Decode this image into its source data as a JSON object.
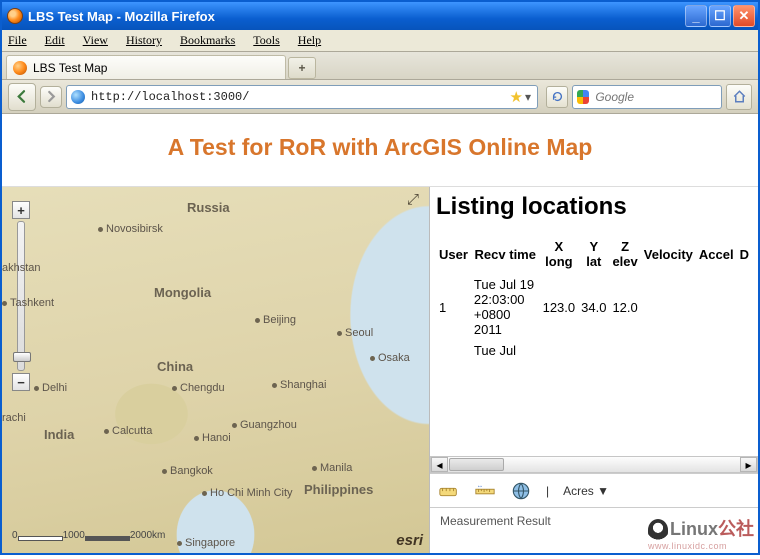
{
  "window": {
    "title": "LBS Test Map - Mozilla Firefox"
  },
  "menu": {
    "file": "File",
    "edit": "Edit",
    "view": "View",
    "history": "History",
    "bookmarks": "Bookmarks",
    "tools": "Tools",
    "help": "Help"
  },
  "tab": {
    "title": "LBS Test Map",
    "newtab": "+"
  },
  "address": {
    "url": "http://localhost:3000/"
  },
  "search": {
    "placeholder": "Google"
  },
  "page": {
    "heading": "A Test for RoR with ArcGIS Online Map",
    "listing_title": "Listing locations",
    "columns": [
      "User",
      "Recv time",
      "X long",
      "Y lat",
      "Z elev",
      "Velocity",
      "Accel",
      "D"
    ],
    "rows": [
      {
        "user": "1",
        "recv": "Tue Jul 19 22:03:00 +0800 2011",
        "x": "123.0",
        "y": "34.0",
        "z": "12.0",
        "velocity": "",
        "accel": "",
        "d": ""
      },
      {
        "user": "",
        "recv": "Tue Jul",
        "x": "",
        "y": "",
        "z": "",
        "velocity": "",
        "accel": "",
        "d": ""
      }
    ],
    "toolbar": {
      "unit_label": "Acres",
      "separator": "|"
    },
    "measurement_label": "Measurement Result"
  },
  "map": {
    "esri": "esri",
    "expand": "⤢",
    "scale": {
      "a": "0",
      "b": "1000",
      "c": "2000km"
    },
    "places": {
      "russia": "Russia",
      "novosibirsk": "Novosibirsk",
      "mongolia": "Mongolia",
      "kazakhstan": "akhstan",
      "tashkent": "Tashkent",
      "china": "China",
      "beijing": "Beijing",
      "seoul": "Seoul",
      "osaka": "Osaka",
      "chengdu": "Chengdu",
      "shanghai": "Shanghai",
      "delhi": "Delhi",
      "karachi": "rachi",
      "india": "India",
      "calcutta": "Calcutta",
      "guangzhou": "Guangzhou",
      "hanoi": "Hanoi",
      "manila": "Manila",
      "hochiminh": "Ho Chi Minh City",
      "bangkok": "Bangkok",
      "singapore": "Singapore",
      "philippines": "Philippines"
    }
  },
  "watermark": {
    "brand": "Linux",
    "suffix": "公社",
    "sub": "www.linuxidc.com"
  }
}
